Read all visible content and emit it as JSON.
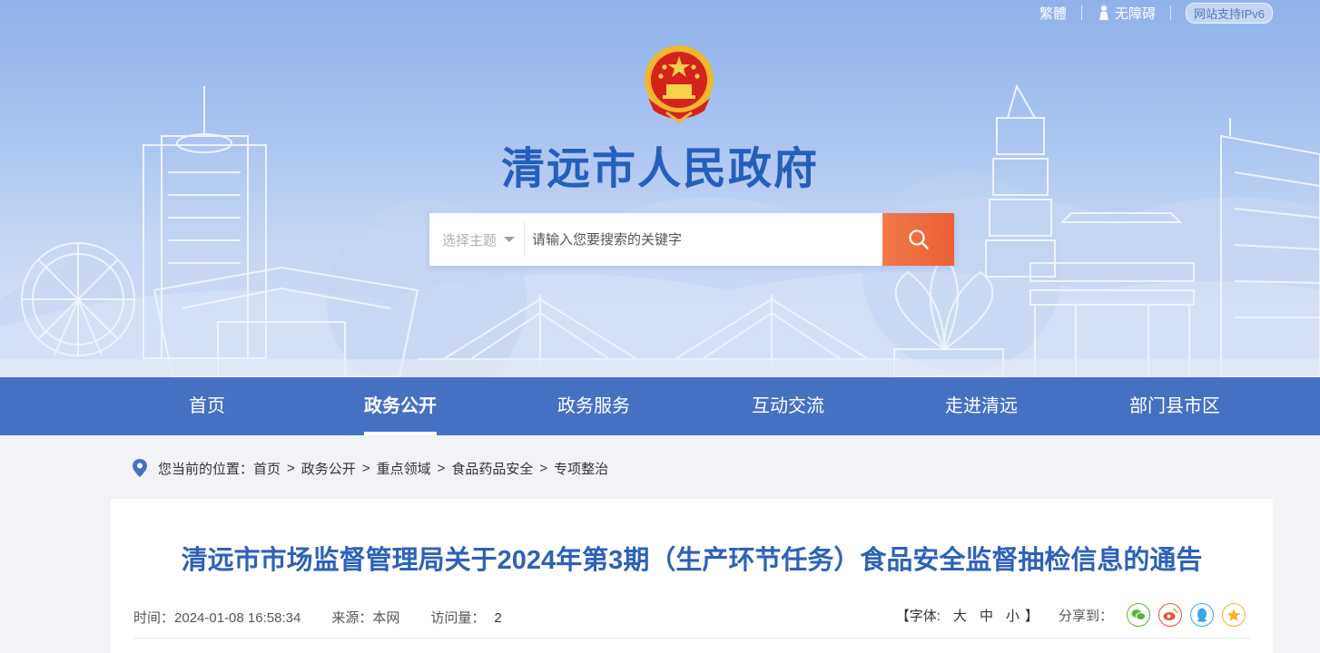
{
  "toplinks": {
    "traditional": "繁體",
    "accessible": "无障碍",
    "ipv6": "网站支持IPv6"
  },
  "site": {
    "title": "清远市人民政府"
  },
  "search": {
    "topic_label": "选择主题",
    "placeholder": "请输入您要搜索的关键字"
  },
  "nav": {
    "items": [
      {
        "label": "首页"
      },
      {
        "label": "政务公开",
        "active": true
      },
      {
        "label": "政务服务"
      },
      {
        "label": "互动交流"
      },
      {
        "label": "走进清远"
      },
      {
        "label": "部门县市区"
      }
    ]
  },
  "breadcrumb": {
    "prefix": "您当前的位置：",
    "items": [
      "首页",
      "政务公开",
      "重点领域",
      "食品药品安全",
      "专项整治"
    ]
  },
  "article": {
    "title": "清远市市场监督管理局关于2024年第3期（生产环节任务）食品安全监督抽检信息的通告",
    "time_label": "时间：",
    "time": "2024-01-08 16:58:34",
    "source_label": "来源：",
    "source": "本网",
    "visits_label": "访问量：",
    "visits": "2",
    "font_label": "【字体:",
    "font_large": "大",
    "font_medium": "中",
    "font_small": "小",
    "font_close": "】",
    "share_label": "分享到："
  },
  "colors": {
    "nav_bg": "#4571c3",
    "title_blue": "#2d62b8",
    "search_button": "#ec5f33",
    "wechat": "#5db53b",
    "weibo": "#e5523a",
    "qq": "#3ba7e6",
    "qzone": "#f3b42b"
  }
}
